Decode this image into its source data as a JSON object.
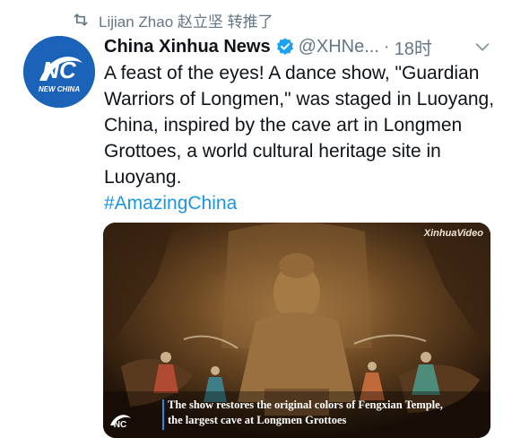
{
  "retweet": {
    "label": "Lijian Zhao 赵立坚 转推了",
    "icon": "retweet-icon"
  },
  "tweet": {
    "author_name": "China Xinhua News",
    "handle": "@XHNe...",
    "separator": "·",
    "time": "18时",
    "verified": true,
    "text": "A feast of the eyes! A dance show, \"Guardian Warriors of Longmen,\" was staged in Luoyang, China, inspired by the cave art in Longmen Grottoes, a world cultural heritage site in Luoyang.",
    "hashtag": "#AmazingChina"
  },
  "avatar": {
    "logo_letters": "NC",
    "logo_text": "NEW CHINA",
    "bg_color": "#1a63b8"
  },
  "media": {
    "watermark": "XinhuaVideo",
    "caption_line1": "The show restores the original colors of Fengxian Temple,",
    "caption_line2": "the largest cave at Longmen Grottoes"
  },
  "colors": {
    "link": "#1b95e0",
    "secondary_text": "#657786",
    "verified_badge": "#1da1f2"
  }
}
